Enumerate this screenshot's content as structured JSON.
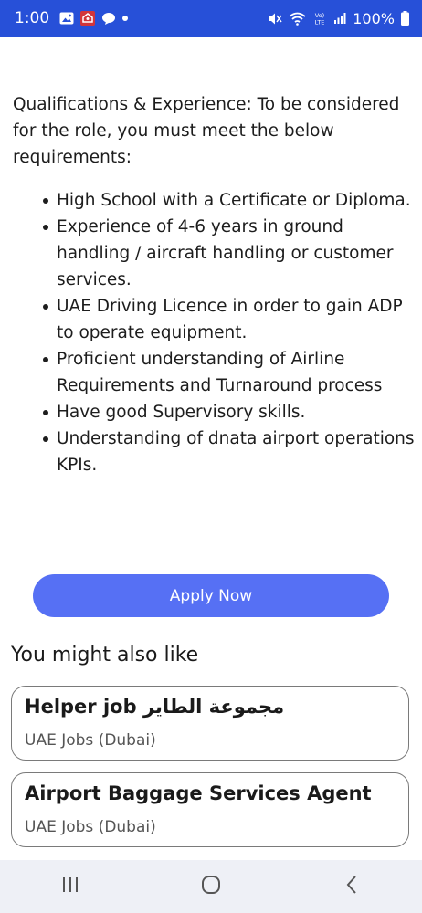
{
  "status_bar": {
    "time": "1:00",
    "battery": "100%",
    "left_icons": [
      "gallery-icon",
      "app-notification-icon",
      "chat-icon",
      "dot-icon"
    ],
    "right_icons": [
      "mute-icon",
      "wifi-icon",
      "volte-icon",
      "signal-icon",
      "battery-icon"
    ],
    "color": "#2750d8"
  },
  "job": {
    "intro": "Qualifications & Experience: To be considered for the role, you must meet the below requirements:",
    "requirements": [
      "High School with a Certificate or Diploma.",
      "Experience of 4-6 years in ground handling / aircraft handling or customer services.",
      "UAE Driving Licence in order to gain ADP to operate equipment.",
      "Proficient understanding of Airline Requirements and Turnaround process",
      "Have good Supervisory skills.",
      "Understanding of dnata airport operations KPIs."
    ]
  },
  "apply_button": {
    "label": "Apply Now",
    "color": "#5670f4"
  },
  "recommendations": {
    "title": "You might also like",
    "items": [
      {
        "title": "Helper job مجموعة الطاير",
        "location": "UAE Jobs (Dubai)"
      },
      {
        "title": "Airport Baggage Services Agent",
        "location": "UAE Jobs (Dubai)"
      }
    ]
  },
  "nav_bar": {
    "buttons": [
      "recent-apps-icon",
      "home-icon",
      "back-icon"
    ]
  }
}
